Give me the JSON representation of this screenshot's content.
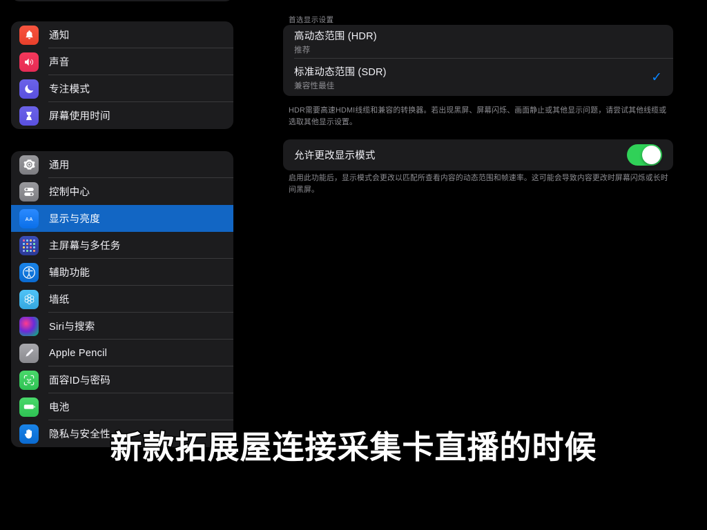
{
  "sidebar": {
    "group_top_partial": true,
    "groups": [
      {
        "name": "alerts-group",
        "items": [
          {
            "label": "通知",
            "icon": "bell-icon",
            "color": "#f8553f",
            "selected": false
          },
          {
            "label": "声音",
            "icon": "speaker-icon",
            "color": "#f4385a",
            "selected": false
          },
          {
            "label": "专注模式",
            "icon": "moon-icon",
            "color": "#6b63e8",
            "selected": false
          },
          {
            "label": "屏幕使用时间",
            "icon": "hourglass-icon",
            "color": "#6b63e8",
            "selected": false
          }
        ]
      },
      {
        "name": "system-group",
        "items": [
          {
            "label": "通用",
            "icon": "gear-icon",
            "color": "#9a9a9e",
            "selected": false
          },
          {
            "label": "控制中心",
            "icon": "toggles-icon",
            "color": "#9a9a9e",
            "selected": false
          },
          {
            "label": "显示与亮度",
            "icon": "aa-text-icon",
            "color": "#2b8aff",
            "selected": true
          },
          {
            "label": "主屏幕与多任务",
            "icon": "app-grid-icon",
            "color": "#3b4eb8",
            "selected": false
          },
          {
            "label": "辅助功能",
            "icon": "accessibility-icon",
            "color": "#1a84e8",
            "selected": false
          },
          {
            "label": "墙纸",
            "icon": "wallpaper-flower-icon",
            "color": "#4fc3f7",
            "selected": false
          },
          {
            "label": "Siri与搜索",
            "icon": "siri-orb-icon",
            "color": "#ff3b8d",
            "selected": false
          },
          {
            "label": "Apple Pencil",
            "icon": "pencil-icon",
            "color": "#a8a8ad",
            "selected": false
          },
          {
            "label": "面容ID与密码",
            "icon": "face-id-icon",
            "color": "#49d86a",
            "selected": false
          },
          {
            "label": "电池",
            "icon": "battery-icon",
            "color": "#49d86a",
            "selected": false
          },
          {
            "label": "隐私与安全性",
            "icon": "hand-raised-icon",
            "color": "#1a84e8",
            "selected": false
          }
        ]
      }
    ],
    "selection_color": "#1266c4"
  },
  "main": {
    "preferred_display": {
      "header": "首选显示设置",
      "options": [
        {
          "title": "高动态范围 (HDR)",
          "subtitle": "推荐",
          "checked": false
        },
        {
          "title": "标准动态范围 (SDR)",
          "subtitle": "兼容性最佳",
          "checked": true
        }
      ],
      "checkmark": "✓",
      "checkmark_color": "#0a84ff",
      "footnote": "HDR需要高速HDMI线缆和兼容的转换器。若出现黑屏、屏幕闪烁、画面静止或其他显示问题，请尝试其他线缆或选取其他显示设置。"
    },
    "allow_change": {
      "title": "允许更改显示模式",
      "toggle_on": true,
      "toggle_color": "#30d158",
      "footnote": "启用此功能后，显示模式会更改以匹配所查看内容的动态范围和帧速率。这可能会导致内容更改时屏幕闪烁或长时间黑屏。"
    }
  },
  "caption": {
    "text": "新款拓展屋连接采集卡直播的时候"
  }
}
